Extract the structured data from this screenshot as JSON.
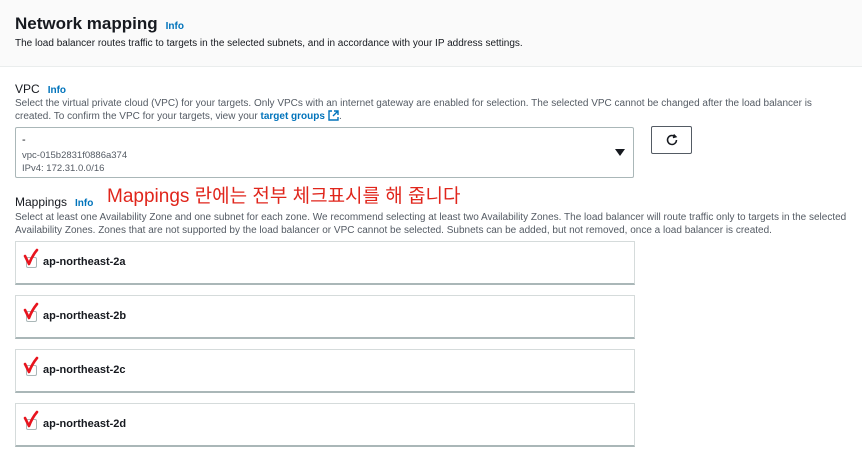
{
  "section": {
    "title": "Network mapping",
    "info": "Info",
    "description": "The load balancer routes traffic to targets in the selected subnets, and in accordance with your IP address settings."
  },
  "vpc": {
    "label": "VPC",
    "info": "Info",
    "description_prefix": "Select the virtual private cloud (VPC) for your targets. Only VPCs with an internet gateway are enabled for selection. The selected VPC cannot be changed after the load balancer is created. To confirm the VPC for your targets, view your ",
    "description_link": "target groups",
    "selected": {
      "name": "-",
      "id": "vpc-015b2831f0886a374",
      "cidr": "IPv4: 172.31.0.0/16"
    },
    "refresh_icon": "refresh-icon"
  },
  "mappings": {
    "label": "Mappings",
    "info": "Info",
    "description": "Select at least one Availability Zone and one subnet for each zone. We recommend selecting at least two Availability Zones. The load balancer will route traffic only to targets in the selected Availability Zones. Zones that are not supported by the load balancer or VPC cannot be selected. Subnets can be added, but not removed, once a load balancer is created.",
    "annotation": "Mappings 란에는 전부 체크표시를 해 줍니다",
    "zones": [
      {
        "name": "ap-northeast-2a",
        "checked": true
      },
      {
        "name": "ap-northeast-2b",
        "checked": true
      },
      {
        "name": "ap-northeast-2c",
        "checked": true
      },
      {
        "name": "ap-northeast-2d",
        "checked": true
      }
    ]
  },
  "colors": {
    "link": "#0073bb",
    "annotation": "#e0261c",
    "check_mark": "#e8141e"
  }
}
